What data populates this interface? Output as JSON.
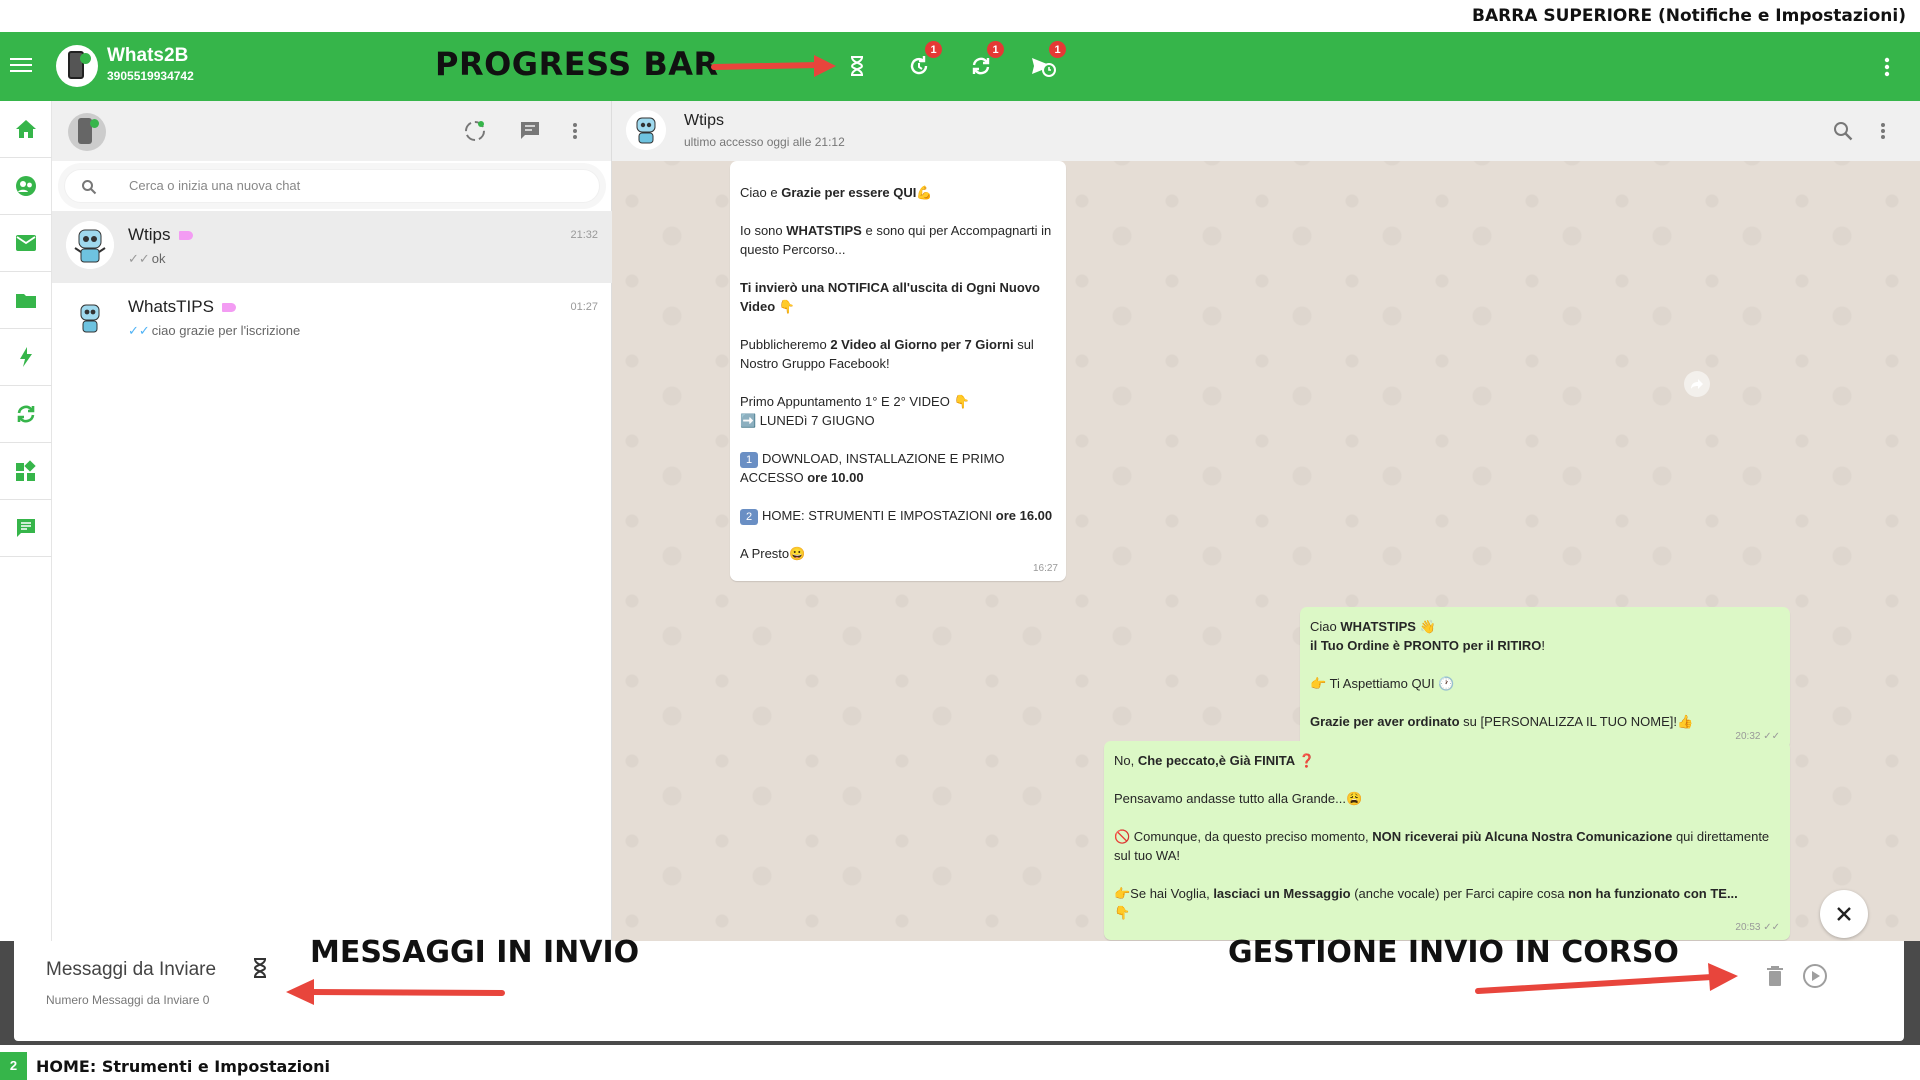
{
  "top_caption": "BARRA SUPERIORE (Notifiche e Impostazioni)",
  "appbar": {
    "app_name": "Whats2B",
    "phone": "3905519934742",
    "progress_label": "PROGRESS BAR",
    "badges": {
      "history": "1",
      "sync": "1",
      "scheduled": "1"
    }
  },
  "sidebar_icons": [
    "home-icon",
    "contacts-icon",
    "mail-icon",
    "folder-icon",
    "bolt-icon",
    "refresh-icon",
    "widgets-icon",
    "feedback-icon"
  ],
  "chatlist": {
    "search_placeholder": "Cerca o inizia una nuova chat",
    "chats": [
      {
        "name": "Wtips",
        "last": "ok",
        "time": "21:32"
      },
      {
        "name": "WhatsTIPS",
        "last": "ciao grazie per l'iscrizione",
        "time": "01:27"
      }
    ]
  },
  "conversation": {
    "contact": "Wtips",
    "last_seen": "ultimo accesso oggi alle 21:12",
    "msg1": {
      "l1a": "Ciao e ",
      "l1b": "Grazie per essere QUI",
      "l1c": "💪",
      "l2a": "Io sono ",
      "l2b": "WHATSTIPS",
      "l2c": " e sono qui per Accompagnarti in questo Percorso...",
      "l3": "Ti invierò una NOTIFICA all'uscita di Ogni Nuovo Video 👇",
      "l4a": "Pubblicheremo ",
      "l4b": "2 Video al Giorno per 7 Giorni",
      "l4c": " sul Nostro Gruppo Facebook!",
      "l5a": "Primo Appuntamento 1° E 2° VIDEO 👇",
      "l5b": "➡️ LUNEDì 7 GIUGNO",
      "l6num": "1",
      "l6a": "DOWNLOAD, INSTALLAZIONE E PRIMO ACCESSO ",
      "l6b": "ore 10.00",
      "l7num": "2",
      "l7a": "HOME: STRUMENTI E IMPOSTAZIONI ",
      "l7b": "ore 16.00",
      "l8": "A Presto😀",
      "time": "16:27"
    },
    "msg2": {
      "l1a": "Ciao ",
      "l1b": "WHATSTIPS",
      "l1c": " 👋",
      "l1d": "il Tuo Ordine è PRONTO per il RITIRO",
      "l1e": "!",
      "l2": "👉 Ti Aspettiamo QUI 🕐",
      "l3a": "Grazie per aver ordinato",
      "l3b": " su [PERSONALIZZA IL TUO NOME]!👍",
      "time": "20:32"
    },
    "msg3": {
      "l1a": "No, ",
      "l1b": "Che peccato,è Già FINITA",
      "l1c": " ❓",
      "l2": "Pensavamo andasse tutto alla Grande...😩",
      "l3a": "🚫 Comunque, da questo preciso momento, ",
      "l3b": "NON riceverai più Alcuna Nostra Comunicazione",
      "l3c": " qui direttamente sul tuo WA!",
      "l4a": "👉Se hai Voglia, ",
      "l4b": "lasciaci un Messaggio",
      "l4c": " (anche vocale) per Farci capire cosa ",
      "l4d": "non ha funzionato con TE...",
      "l4e": "👇",
      "time": "20:53"
    }
  },
  "sendpanel": {
    "title": "Messaggi da Inviare",
    "subtitle": "Numero Messaggi da Inviare 0",
    "label_left": "MESSAGGI IN INVIO",
    "label_right": "GESTIONE INVIO IN CORSO"
  },
  "footer": {
    "num": "2",
    "text": "HOME: Strumenti e Impostazioni"
  },
  "colors": {
    "accent_green": "#36b54a",
    "arrow_red": "#e8453c",
    "bubble_out": "#dcf8c6",
    "badge_red": "#e53935"
  }
}
